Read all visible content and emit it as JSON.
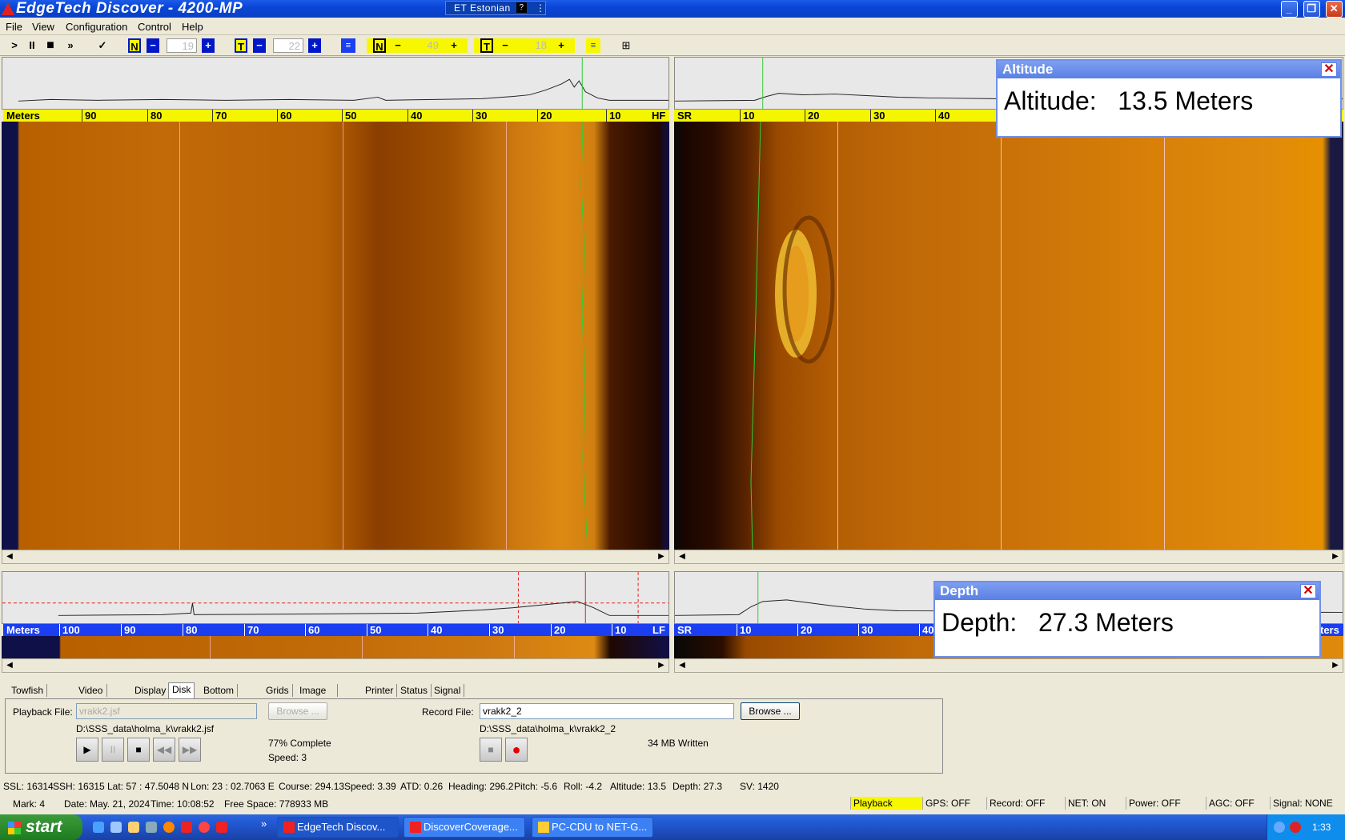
{
  "window": {
    "title": "EdgeTech  Discover  -  4200-MP",
    "language": "ET Estonian",
    "lang_help": "?",
    "controls": {
      "minimize": "_",
      "restore": "❐",
      "close": "✕"
    }
  },
  "menu": [
    "File",
    "View",
    "Configuration",
    "Control",
    "Help"
  ],
  "toolbar": {
    "n1": "N",
    "minus1": "−",
    "val1": "19",
    "plus1": "+",
    "t1": "T",
    "minus2": "−",
    "val2": "22",
    "plus2": "+",
    "n2": "N",
    "minus3": "−",
    "val3": "49",
    "plus3": "+",
    "t2": "T",
    "minus4": "−",
    "val4": "18",
    "plus4": "+"
  },
  "hf_scale": {
    "label": "Meters",
    "ticks": [
      "90",
      "80",
      "70",
      "60",
      "50",
      "40",
      "30",
      "20",
      "10"
    ],
    "end": "HF"
  },
  "sr_scale_top": {
    "label": "SR",
    "ticks": [
      "10",
      "20",
      "30",
      "40"
    ]
  },
  "lf_scale": {
    "label": "Meters",
    "ticks": [
      "100",
      "90",
      "80",
      "70",
      "60",
      "50",
      "40",
      "30",
      "20",
      "10"
    ],
    "end": "LF"
  },
  "sr_scale_bottom": {
    "label": "SR",
    "ticks": [
      "10",
      "20",
      "30",
      "40"
    ],
    "end": "ters"
  },
  "altitude_popup": {
    "title": "Altitude",
    "label": "Altitude:",
    "value": "13.5",
    "unit": "Meters",
    "close": "✕"
  },
  "depth_popup": {
    "title": "Depth",
    "label": "Depth:",
    "value": "27.3",
    "unit": "Meters",
    "close": "✕"
  },
  "tabs": [
    "Towfish Control",
    "Video Gains",
    "Display",
    "Disk",
    "Bottom Track",
    "Grids",
    "Image Capture",
    "Printer",
    "Status",
    "Signal"
  ],
  "active_tab": "Disk",
  "disk": {
    "playback_label": "Playback File:",
    "playback_value": "vrakk2.jsf",
    "browse_disabled": "Browse ...",
    "playback_path": "D:\\SSS_data\\holma_k\\vrakk2.jsf",
    "complete": "77% Complete",
    "speed": "Speed: 3",
    "record_label": "Record File:",
    "record_value": "vrakk2_2",
    "browse": "Browse ...",
    "record_path": "D:\\SSS_data\\holma_k\\vrakk2_2",
    "written": "34 MB Written"
  },
  "status": {
    "ssl": "SSL: 16314",
    "ssh": "SSH: 16315",
    "lat": "Lat:   57 : 47.5048 N",
    "lon": "Lon:   23 : 02.7063 E",
    "course": "Course: 294.13",
    "speed": "Speed:  3.39",
    "atd": "ATD:  0.26",
    "heading": "Heading: 296.2",
    "pitch": "Pitch:   -5.6",
    "roll": "Roll:   -4.2",
    "altitude": "Altitude:   13.5",
    "depth": "Depth:   27.3",
    "sv": "SV:  1420",
    "mark": "Mark:      4",
    "date": "Date: May. 21, 2024",
    "time": "Time: 10:08:52",
    "free": "Free Space: 778933 MB"
  },
  "indicators": [
    "Playback",
    "GPS: OFF",
    "Record: OFF",
    "NET: ON",
    "Power: OFF",
    "AGC: OFF",
    "Signal: NONE"
  ],
  "taskbar": {
    "start": "start",
    "more": "»",
    "tasks": [
      "EdgeTech  Discov...",
      "DiscoverCoverage...",
      "PC-CDU to NET-G..."
    ],
    "clock": "1:33"
  },
  "colors": {
    "sonar_dark": "#3a1400",
    "sonar_mid": "#b05a00",
    "sonar_bright": "#e69000",
    "accent_yellow": "#f5f500",
    "accent_blue": "#1a3ef0"
  }
}
